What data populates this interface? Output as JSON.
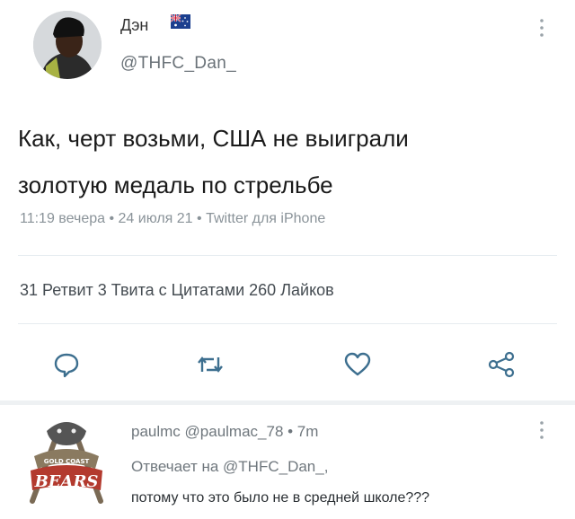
{
  "tweet": {
    "display_name": "Дэн",
    "flag_icon": "australia-flag-icon",
    "handle": "@THFC_Dan_",
    "text_line1": "Как, черт возьми, США не выиграли",
    "text_line2": "золотую медаль по стрельбе",
    "meta": "11:19 вечера • 24 июля 21 • Twitter для iPhone",
    "stats": "31 Ретвит 3 Твита с Цитатами 260 Лайков",
    "actions": [
      "reply-icon",
      "retweet-icon",
      "like-icon",
      "share-icon"
    ]
  },
  "reply": {
    "header": "paulmc @paulmac_78 • 7m",
    "replying_prefix": "Отвечает на ",
    "replying_handle": "@THFC_Dan_,",
    "text": "потому что это было не в средней школе???",
    "avatar_text_top": "GOLD COAST",
    "avatar_text_main": "BEARS"
  },
  "colors": {
    "secondary_text": "#6f777d",
    "divider": "#e6ecf0",
    "icon": "#3d6f8f"
  }
}
